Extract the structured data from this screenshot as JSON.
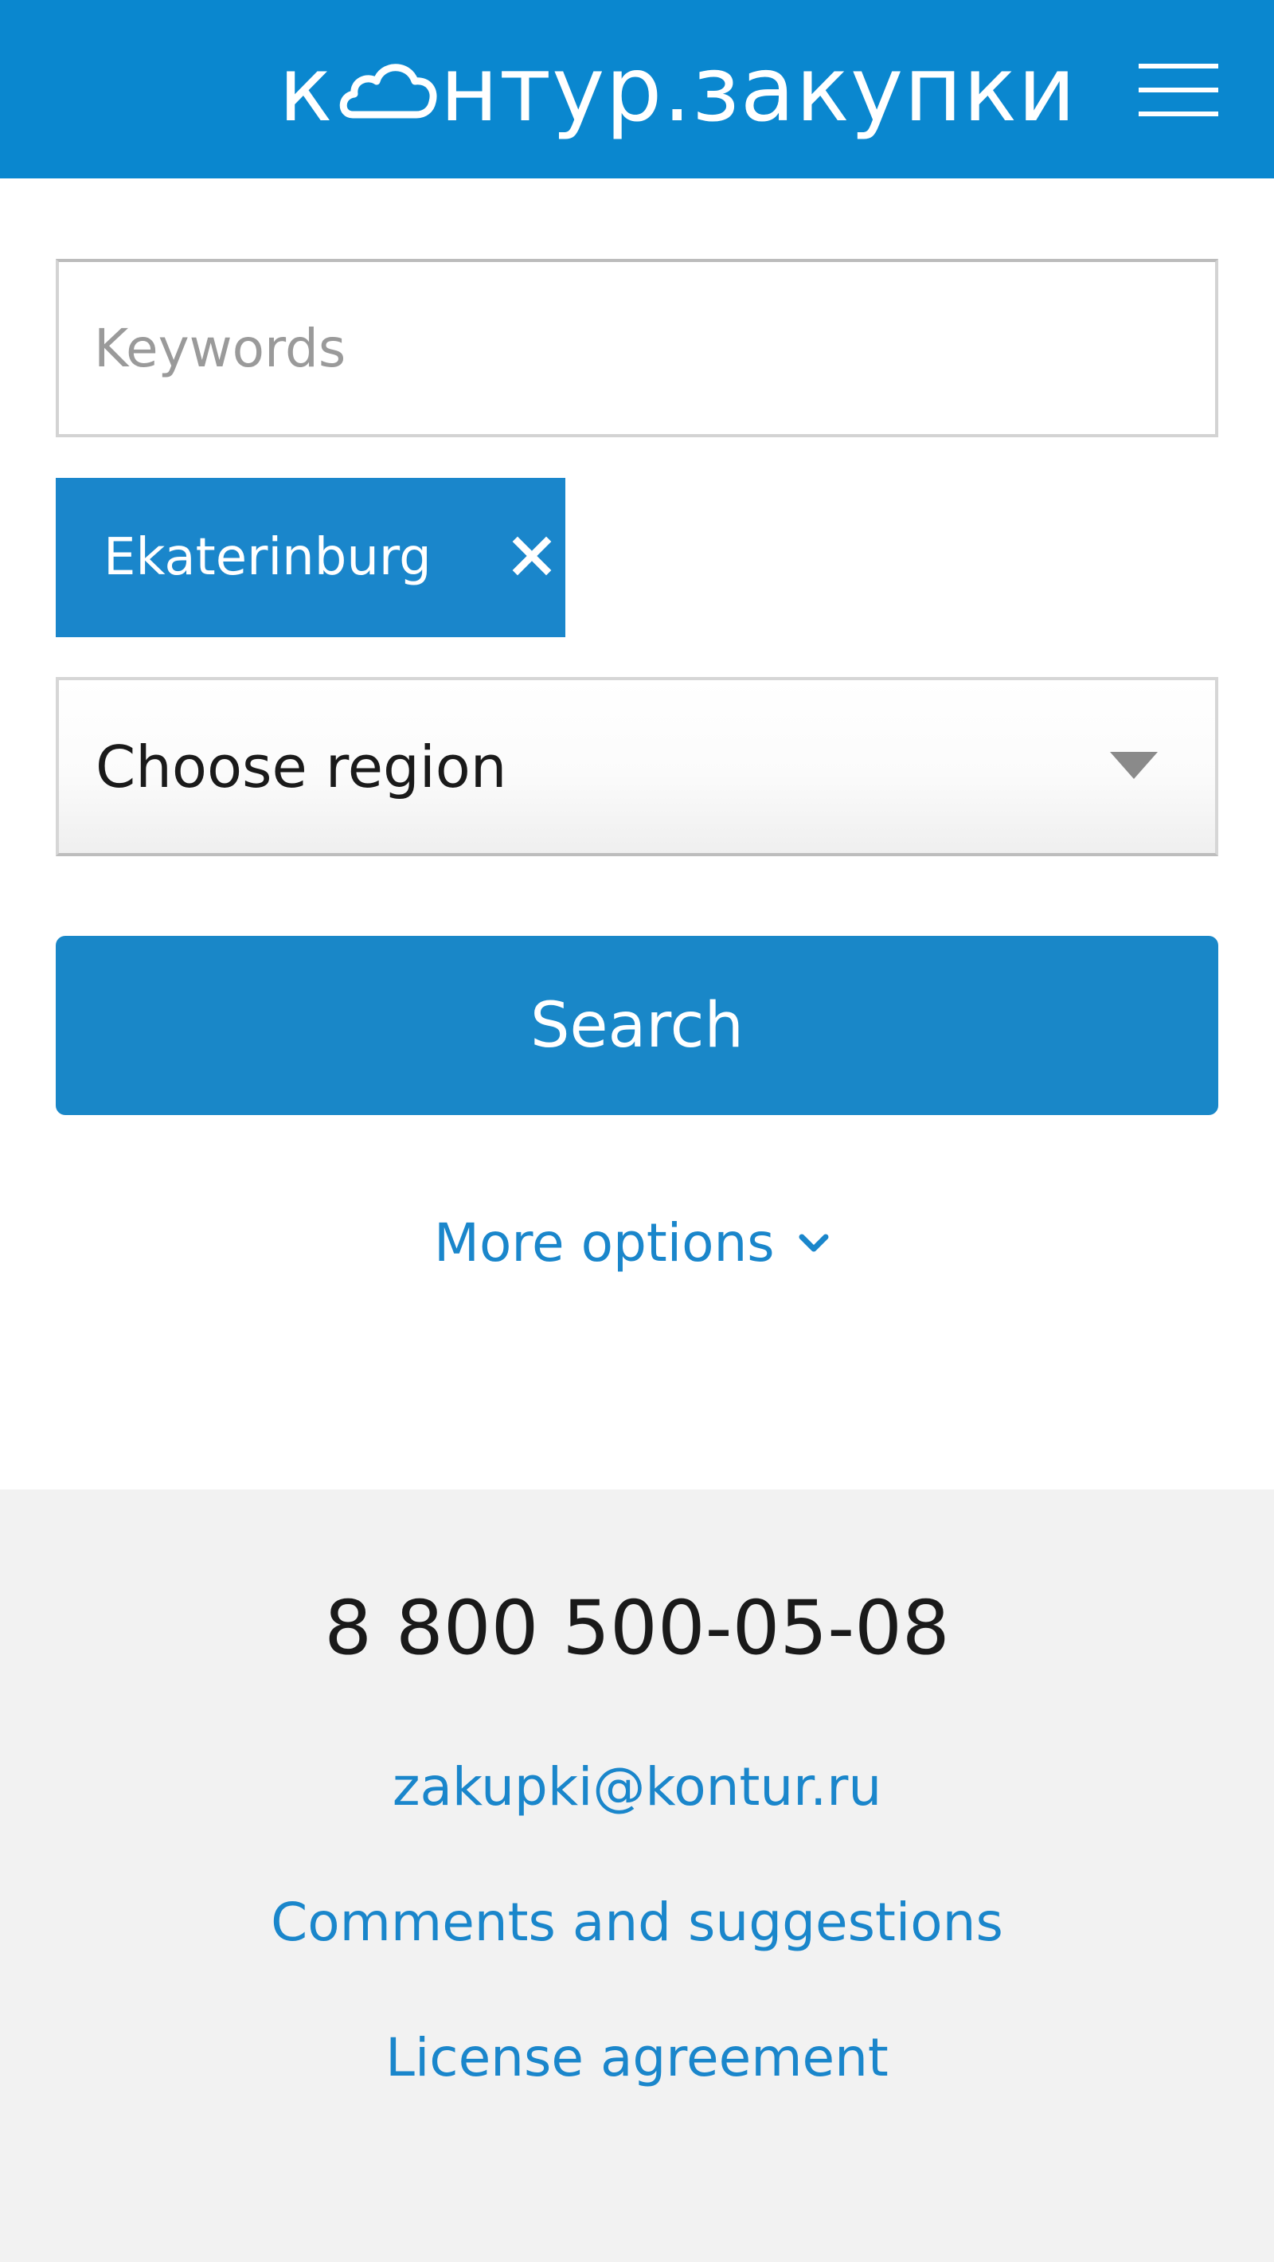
{
  "header": {
    "logo_part1": "к",
    "logo_part2": "нтур.закупки",
    "icons": {
      "logo": "cloud-icon",
      "menu": "hamburger-menu-icon"
    },
    "background_color": "#0a87cf"
  },
  "search": {
    "keywords_placeholder": "Keywords",
    "keywords_value": "",
    "selected_city": "Ekaterinburg",
    "region_select_label": "Choose region",
    "search_button_label": "Search",
    "more_options_label": "More options",
    "icons": {
      "remove": "close-icon",
      "select": "caret-down-icon",
      "more": "chevron-down-icon"
    }
  },
  "footer": {
    "phone": "8 800 500-05-08",
    "email": "zakupki@kontur.ru",
    "comments_link": "Comments and suggestions",
    "license_link": "License agreement",
    "background_color": "#f2f2f2"
  },
  "colors": {
    "accent": "#1a86cb",
    "text": "#1a1a1a",
    "placeholder": "#9a9a9a"
  }
}
